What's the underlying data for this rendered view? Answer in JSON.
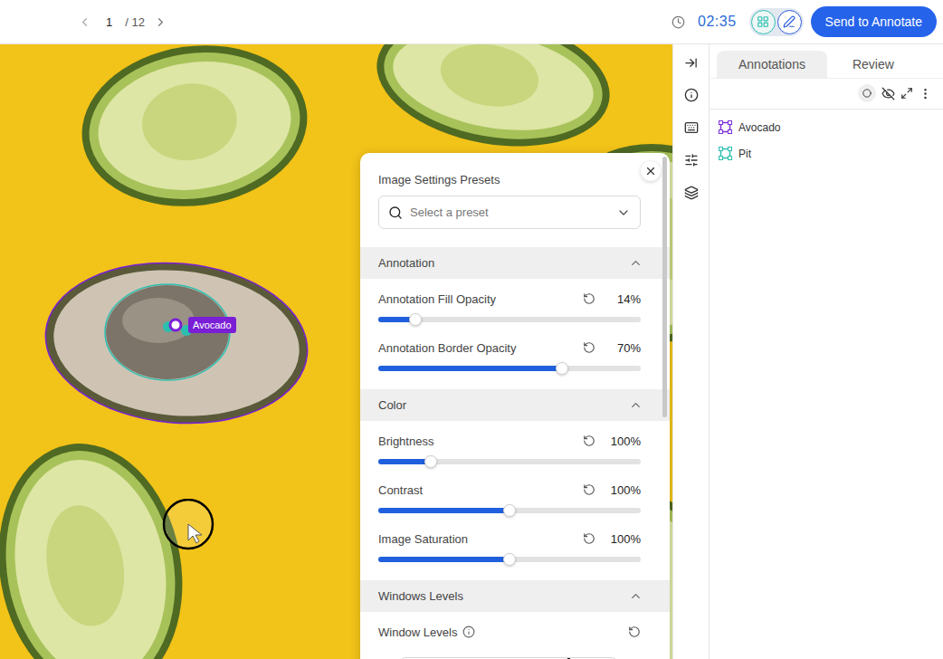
{
  "pagination": {
    "current": "1",
    "total": "/ 12"
  },
  "timer": "02:35",
  "modes": [
    {
      "selected": false
    },
    {
      "selected": true
    }
  ],
  "send_button": "Send to Annotate",
  "canvas": {
    "label": {
      "text": "Avocado",
      "color": "#7a1fd6"
    }
  },
  "settings": {
    "presets_title": "Image Settings Presets",
    "preset_placeholder": "Select a preset",
    "sections": [
      {
        "title": "Annotation",
        "expanded": true,
        "rows": [
          {
            "kind": "slider",
            "label": "Annotation Fill Opacity",
            "value": "14%",
            "level": 0.14
          },
          {
            "kind": "slider",
            "label": "Annotation Border Opacity",
            "value": "70%",
            "level": 0.7
          }
        ]
      },
      {
        "title": "Color",
        "expanded": true,
        "rows": [
          {
            "kind": "slider",
            "label": "Brightness",
            "value": "100%",
            "level": 0.2
          },
          {
            "kind": "slider",
            "label": "Contrast",
            "value": "100%",
            "level": 0.5
          },
          {
            "kind": "slider",
            "label": "Image Saturation",
            "value": "100%",
            "level": 0.5
          }
        ]
      },
      {
        "title": "Windows Levels",
        "expanded": true,
        "rows": [
          {
            "kind": "levels",
            "label": "Window Levels"
          }
        ]
      }
    ]
  },
  "side_tabs": [
    {
      "label": "Annotations",
      "selected": true
    },
    {
      "label": "Review",
      "selected": false
    }
  ],
  "classes": [
    {
      "label": "Avocado",
      "color": "#7b2fd6"
    },
    {
      "label": "Pit",
      "color": "#2bbfb0"
    }
  ]
}
